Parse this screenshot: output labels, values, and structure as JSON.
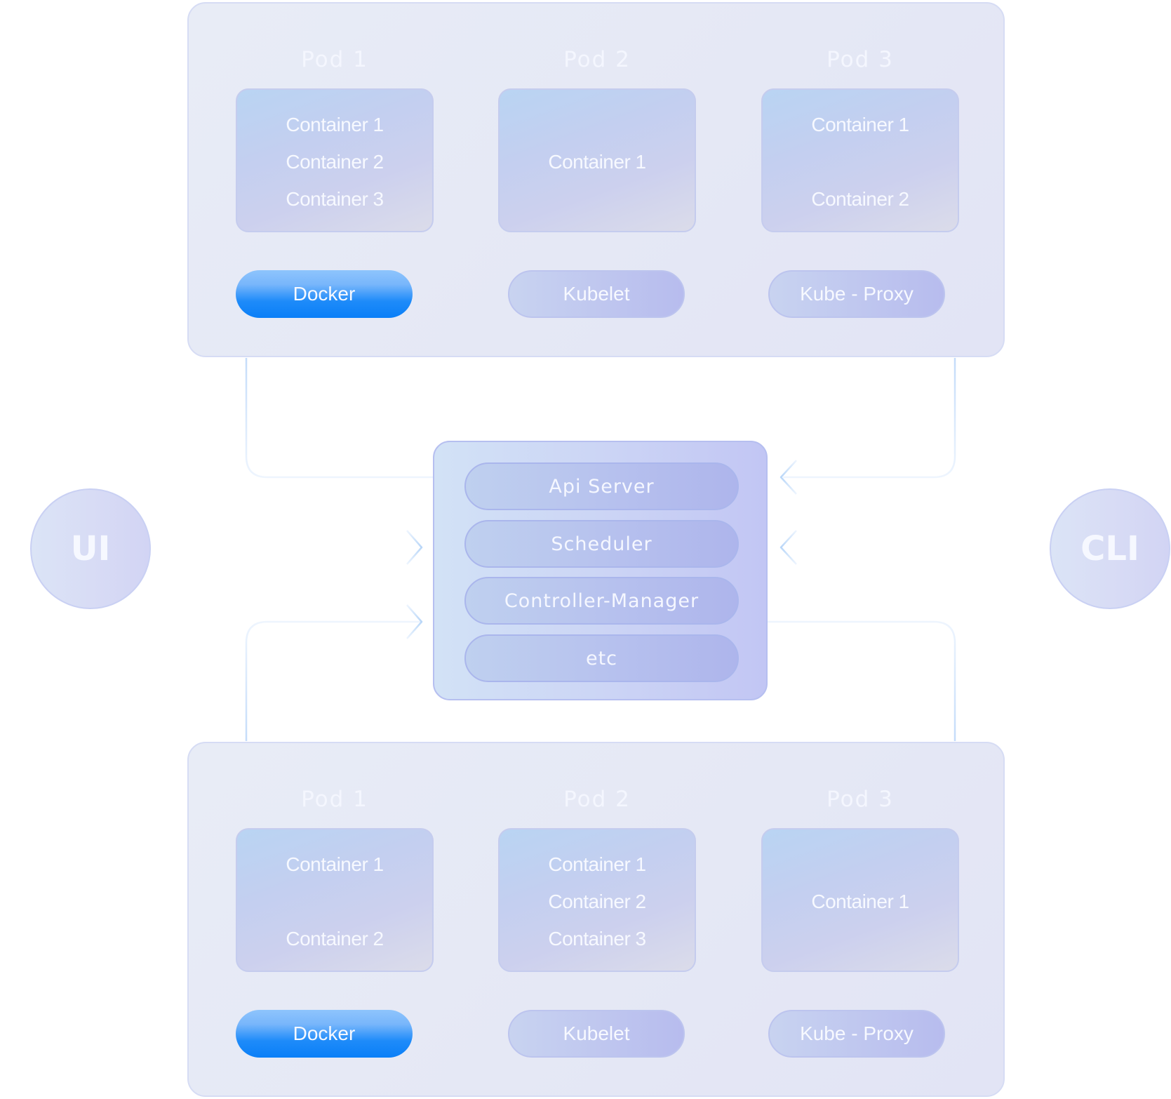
{
  "clients": {
    "left": "UI",
    "right": "CLI"
  },
  "master": {
    "components": [
      "Api Server",
      "Scheduler",
      "Controller-Manager",
      "etc"
    ]
  },
  "nodes": [
    {
      "pods": [
        {
          "title": "Pod 1",
          "containers": [
            "Container 1",
            "Container 2",
            "Container 3"
          ]
        },
        {
          "title": "Pod 2",
          "containers": [
            "Container 1"
          ]
        },
        {
          "title": "Pod 3",
          "containers": [
            "Container 1",
            "Container 2"
          ]
        }
      ],
      "services": [
        "Docker",
        "Kubelet",
        "Kube - Proxy"
      ]
    },
    {
      "pods": [
        {
          "title": "Pod 1",
          "containers": [
            "Container 1",
            "Container 2"
          ]
        },
        {
          "title": "Pod 2",
          "containers": [
            "Container 1",
            "Container 2",
            "Container 3"
          ]
        },
        {
          "title": "Pod 3",
          "containers": [
            "Container 1"
          ]
        }
      ],
      "services": [
        "Docker",
        "Kubelet",
        "Kube - Proxy"
      ]
    }
  ],
  "colors": {
    "docker_accent": "#0a7ff8",
    "connector": "#cfe3fb"
  }
}
